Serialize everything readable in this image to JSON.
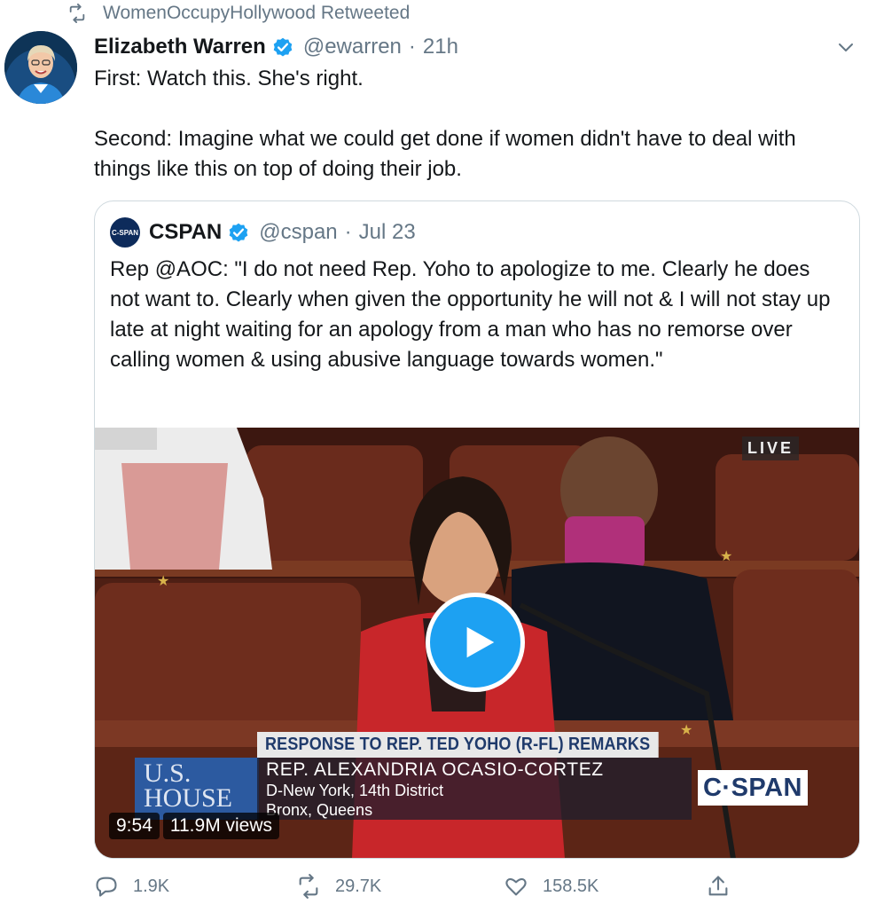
{
  "retweet_context": {
    "label": "WomenOccupyHollywood Retweeted",
    "icon": "retweet-icon"
  },
  "tweet": {
    "author_name": "Elizabeth Warren",
    "verified": true,
    "handle": "@ewarren",
    "separator": "·",
    "time": "21h",
    "text_line1": "First: Watch this. She's right.",
    "text_line2": "Second: Imagine what we could get done if women didn't have to deal with things like this on top of doing their job."
  },
  "quoted_tweet": {
    "avatar_text": "C-SPAN",
    "author_name": "CSPAN",
    "verified": true,
    "handle": "@cspan",
    "separator": "·",
    "date": "Jul 23",
    "text": "Rep @AOC: \"I do not need Rep. Yoho to apologize to me. Clearly he does not want to. Clearly when given the opportunity he will not & I will not stay up late at night waiting for an apology from a man who has no remorse over calling women & using abusive language towards women.\"",
    "video": {
      "live_label": "LIVE",
      "chyron_title": "RESPONSE TO REP. TED YOHO (R-FL) REMARKS",
      "chyron_name": "REP. ALEXANDRIA OCASIO-CORTEZ",
      "chyron_line2": "D-New York, 14th District",
      "chyron_line3": "Bronx, Queens",
      "house_logo_line1": "U.S.",
      "house_logo_line2": "HOUSE",
      "network_logo": "C·SPAN",
      "duration": "9:54",
      "views": "11.9M views"
    }
  },
  "actions": {
    "reply_count": "1.9K",
    "retweet_count": "29.7K",
    "like_count": "158.5K"
  },
  "colors": {
    "verified_blue": "#1da1f2",
    "secondary_text": "#657786",
    "border": "#cfd9de"
  }
}
